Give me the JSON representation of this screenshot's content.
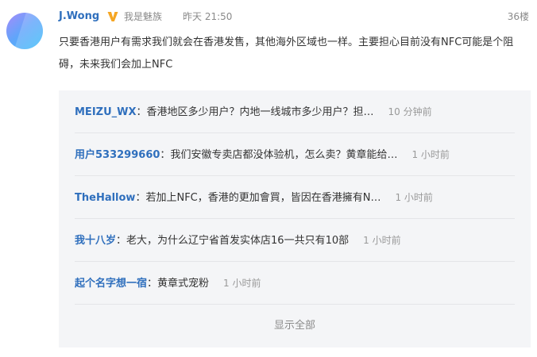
{
  "post": {
    "username": "J.Wong",
    "user_tag": "我是魅族",
    "timestamp": "昨天 21:50",
    "floor": "36楼",
    "text": "只要香港用户有需求我们就会在香港发售，其他海外区域也一样。主要担心目前没有NFC可能是个阻碍，未来我们会加上NFC",
    "verified_color": "#f5a623"
  },
  "replies": [
    {
      "user": "MEIZU_WX",
      "text": "香港地区多少用户？内地一线城市多少用户？担…",
      "time": "10 分钟前"
    },
    {
      "user": "用户533299660",
      "text": "我们安徽专卖店都没体验机，怎么卖？黄章能给…",
      "time": "1 小时前"
    },
    {
      "user": "TheHallow",
      "text": "若加上NFC，香港的更加會買，皆因在香港擁有N…",
      "time": "1 小时前"
    },
    {
      "user": "我十八岁",
      "text": "老大，为什么辽宁省首发实体店16一共只有10部",
      "time": "1 小时前"
    },
    {
      "user": "起个名字想一宿",
      "text": "黄章式宠粉",
      "time": "1 小时前"
    }
  ],
  "separator": "：",
  "show_all_label": "显示全部",
  "colors": {
    "link": "#2f6fbd",
    "muted": "#8a8a8a",
    "reply_bg": "#f4f5f7"
  }
}
